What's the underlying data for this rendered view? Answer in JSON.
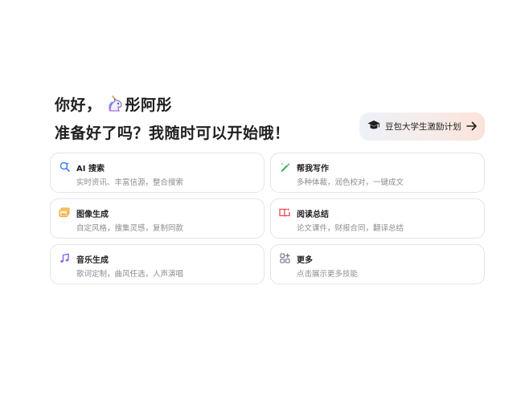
{
  "greeting": {
    "prefix": "你好，",
    "username": "彤阿彤",
    "subline": "准备好了吗？我随时可以开始哦！"
  },
  "promo": {
    "label": "豆包大学生激励计划"
  },
  "cards": [
    {
      "title": "AI 搜索",
      "desc": "实时资讯、丰富信源，整合搜索",
      "icon": "search-icon",
      "color": "#3a7bff"
    },
    {
      "title": "帮我写作",
      "desc": "多种体裁，润色校对，一键成文",
      "icon": "pen-icon",
      "color": "#35b25a"
    },
    {
      "title": "图像生成",
      "desc": "自定风格，搜集灵感，复制同款",
      "icon": "image-icon",
      "color": "#f2a33a"
    },
    {
      "title": "阅读总结",
      "desc": "论文课件，财报合同，翻译总结",
      "icon": "book-icon",
      "color": "#e5484d"
    },
    {
      "title": "音乐生成",
      "desc": "歌词定制，曲风任选，人声演唱",
      "icon": "music-icon",
      "color": "#8b5cf6"
    },
    {
      "title": "更多",
      "desc": "点击展示更多技能",
      "icon": "apps-icon",
      "color": "#6b7280"
    }
  ]
}
